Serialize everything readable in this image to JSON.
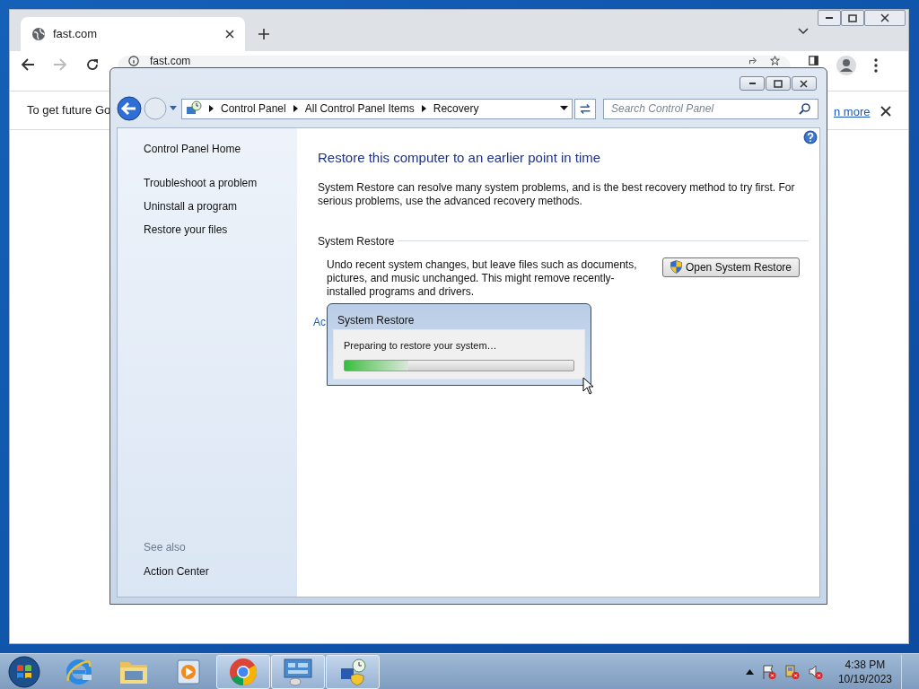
{
  "browser": {
    "tab": {
      "title": "fast.com"
    },
    "address": "fast.com",
    "infobar": {
      "message": "To get future Go",
      "link": "n more"
    }
  },
  "control_panel": {
    "breadcrumb": [
      "Control Panel",
      "All Control Panel Items",
      "Recovery"
    ],
    "search": {
      "placeholder": "Search Control Panel"
    },
    "sidebar": {
      "home": "Control Panel Home",
      "items": [
        "Troubleshoot a problem",
        "Uninstall a program",
        "Restore your files"
      ],
      "see_also_title": "See also",
      "see_also": [
        "Action Center"
      ]
    },
    "heading": "Restore this computer to an earlier point in time",
    "intro": "System Restore can resolve many system problems, and is the best recovery method to try first. For serious problems, use the advanced recovery methods.",
    "section_title": "System Restore",
    "section_text": "Undo recent system changes, but leave files such as documents, pictures, and music unchanged. This might remove recently-installed programs and drivers.",
    "button": "Open System Restore",
    "link": "Ac"
  },
  "dialog": {
    "title": "System Restore",
    "message": "Preparing to restore your system…",
    "level": 0.28
  },
  "taskbar": {
    "apps": [
      {
        "kind": "ie",
        "running": false
      },
      {
        "kind": "explorer",
        "running": false
      },
      {
        "kind": "media",
        "running": false
      },
      {
        "kind": "chrome",
        "running": true
      },
      {
        "kind": "control_panel",
        "running": true
      },
      {
        "kind": "restore",
        "running": true
      }
    ],
    "clock": {
      "time": "4:38 PM",
      "date": "10/19/2023"
    }
  }
}
